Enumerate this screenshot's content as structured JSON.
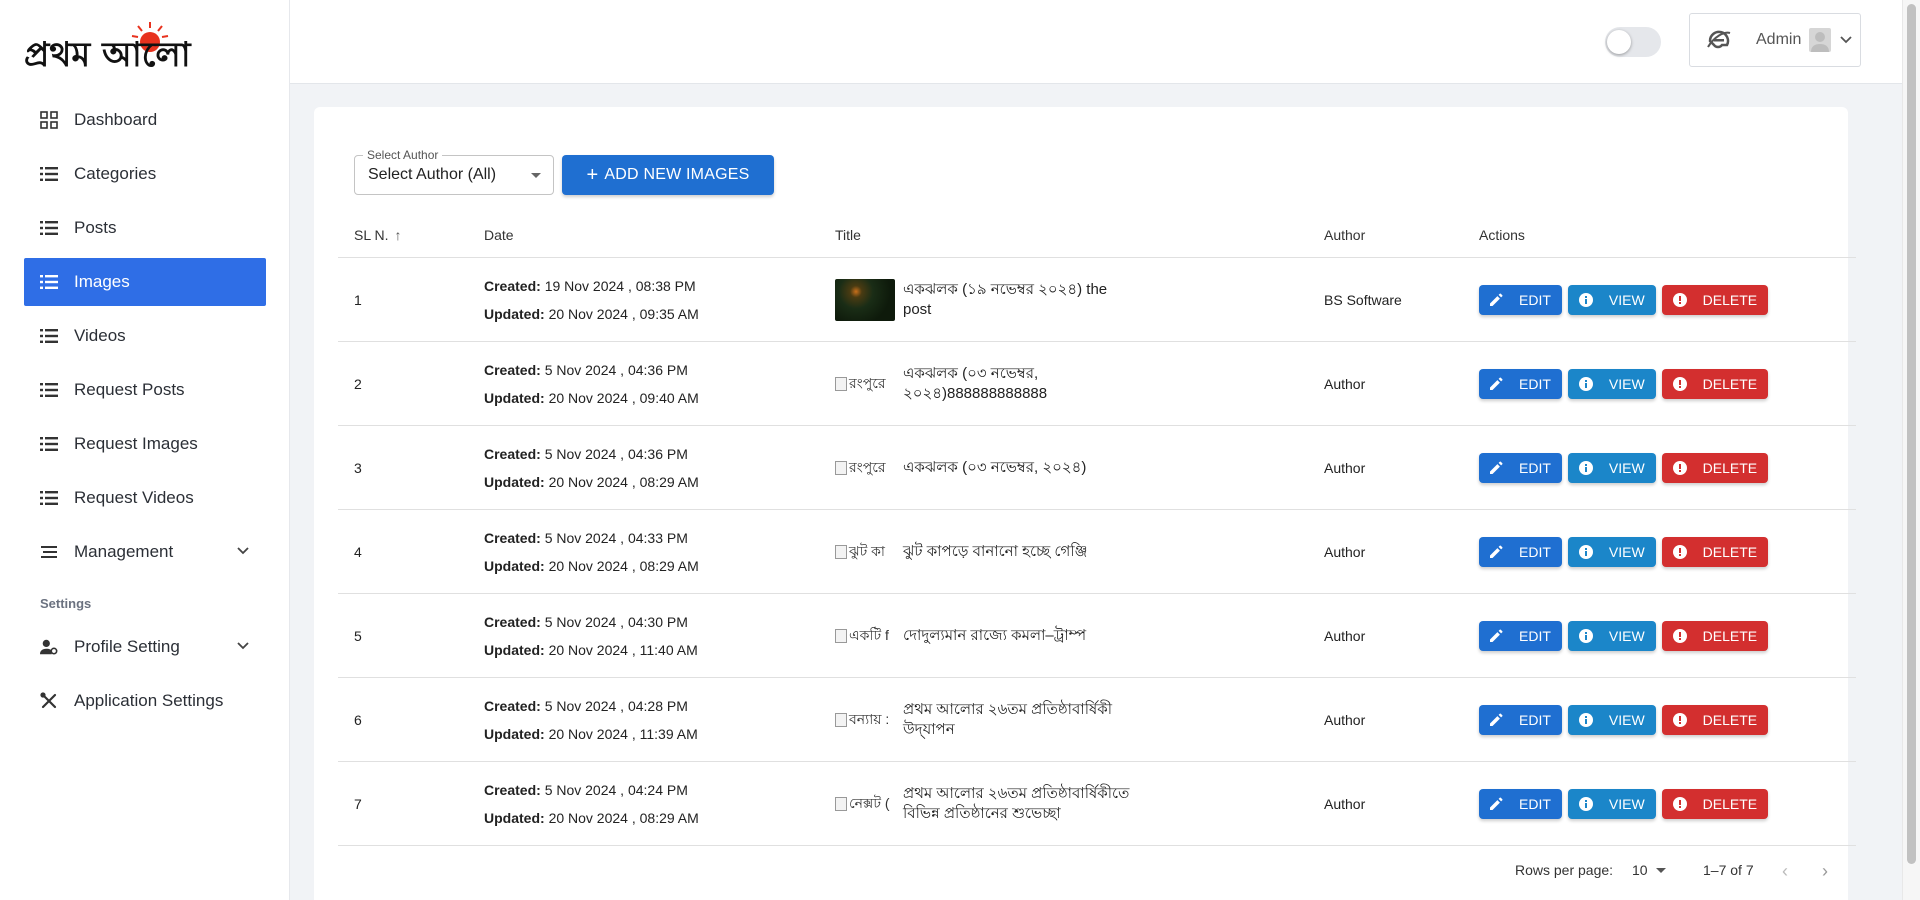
{
  "brand": {
    "logo_text": "প্রথম আলো",
    "accent": "#2f6ee6",
    "sun_color": "#e8321e"
  },
  "sidebar": {
    "items": [
      {
        "label": "Dashboard",
        "icon": "grid-icon"
      },
      {
        "label": "Categories",
        "icon": "list-icon"
      },
      {
        "label": "Posts",
        "icon": "list-icon"
      },
      {
        "label": "Images",
        "icon": "list-icon",
        "active": true
      },
      {
        "label": "Videos",
        "icon": "list-icon"
      },
      {
        "label": "Request Posts",
        "icon": "list-icon"
      },
      {
        "label": "Request Images",
        "icon": "list-icon"
      },
      {
        "label": "Request Videos",
        "icon": "list-icon"
      },
      {
        "label": "Management",
        "icon": "menu-icon",
        "expandable": true
      }
    ],
    "settings_label": "Settings",
    "settings_items": [
      {
        "label": "Profile Setting",
        "icon": "user-gear-icon",
        "expandable": true
      },
      {
        "label": "Application Settings",
        "icon": "tools-icon"
      }
    ]
  },
  "header": {
    "user_name": "Admin",
    "theme_toggle": "off"
  },
  "toolbar": {
    "select_author_legend": "Select Author",
    "select_author_value": "Select Author (All)",
    "add_button_label": "ADD NEW IMAGES"
  },
  "table": {
    "headers": {
      "sl": "SL N.",
      "date": "Date",
      "title": "Title",
      "author": "Author",
      "actions": "Actions"
    },
    "created_label": "Created:",
    "updated_label": "Updated:",
    "action_labels": {
      "edit": "EDIT",
      "view": "VIEW",
      "delete": "DELETE"
    },
    "rows": [
      {
        "sl": "1",
        "created": "19 Nov 2024 , 08:38 PM",
        "updated": "20 Nov 2024 , 09:35 AM",
        "thumb_alt": "",
        "title": "একঝলক (১৯ নভেম্বর ২০২৪) the post",
        "author": "BS Software"
      },
      {
        "sl": "2",
        "created": "5 Nov 2024 , 04:36 PM",
        "updated": "20 Nov 2024 , 09:40 AM",
        "thumb_alt": "রংপুরে",
        "title": "একঝলক (০৩ নভেম্বর, ২০২৪)888888888888",
        "author": "Author"
      },
      {
        "sl": "3",
        "created": "5 Nov 2024 , 04:36 PM",
        "updated": "20 Nov 2024 , 08:29 AM",
        "thumb_alt": "রংপুরে",
        "title": "একঝলক (০৩ নভেম্বর, ২০২৪)",
        "author": "Author"
      },
      {
        "sl": "4",
        "created": "5 Nov 2024 , 04:33 PM",
        "updated": "20 Nov 2024 , 08:29 AM",
        "thumb_alt": "ঝুট কা",
        "title": "ঝুট কাপড়ে বানানো হচ্ছে গেঞ্জি",
        "author": "Author"
      },
      {
        "sl": "5",
        "created": "5 Nov 2024 , 04:30 PM",
        "updated": "20 Nov 2024 , 11:40 AM",
        "thumb_alt": "একটি f",
        "title": "দোদুল্যমান রাজ্যে কমলা–ট্রাম্প",
        "author": "Author"
      },
      {
        "sl": "6",
        "created": "5 Nov 2024 , 04:28 PM",
        "updated": "20 Nov 2024 , 11:39 AM",
        "thumb_alt": "বন্যায় :",
        "title": "প্রথম আলোর ২৬তম প্রতিষ্ঠাবার্ষিকী উদ্‌যাপন",
        "author": "Author"
      },
      {
        "sl": "7",
        "created": "5 Nov 2024 , 04:24 PM",
        "updated": "20 Nov 2024 , 08:29 AM",
        "thumb_alt": "নেক্সট (",
        "title": "প্রথম আলোর ২৬তম প্রতিষ্ঠাবার্ষিকীতে বিভিন্ন প্রতিষ্ঠানের শুভেচ্ছা",
        "author": "Author"
      }
    ]
  },
  "pagination": {
    "rows_per_page_label": "Rows per page:",
    "rows_per_page": "10",
    "range": "1–7 of 7"
  }
}
